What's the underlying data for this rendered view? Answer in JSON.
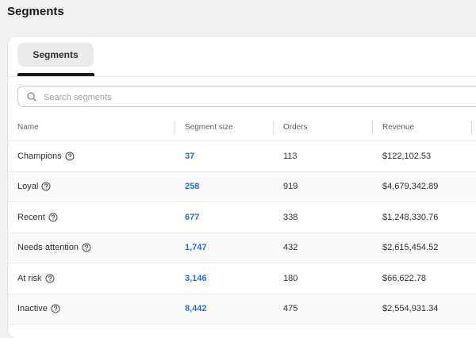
{
  "page": {
    "title": "Segments"
  },
  "tabs": [
    {
      "label": "Segments",
      "selected": true
    }
  ],
  "search": {
    "placeholder": "Search segments",
    "value": ""
  },
  "table": {
    "columns": [
      "Name",
      "Segment size",
      "Orders",
      "Revenue"
    ],
    "rows": [
      {
        "name": "Champions",
        "size": "37",
        "orders": "113",
        "revenue": "$122,102.53"
      },
      {
        "name": "Loyal",
        "size": "258",
        "orders": "919",
        "revenue": "$4,679,342.89"
      },
      {
        "name": "Recent",
        "size": "677",
        "orders": "338",
        "revenue": "$1,248,330.76"
      },
      {
        "name": "Needs attention",
        "size": "1,747",
        "orders": "432",
        "revenue": "$2,615,454.52"
      },
      {
        "name": "At risk",
        "size": "3,146",
        "orders": "180",
        "revenue": "$66,622.78"
      },
      {
        "name": "Inactive",
        "size": "8,442",
        "orders": "475",
        "revenue": "$2,554,931.34"
      }
    ]
  },
  "icons": {
    "search": "search-icon",
    "help": "help-circle-icon"
  },
  "colors": {
    "link": "#2c6ecb",
    "accent": "#1a1a1a",
    "background": "#f1f1f1"
  }
}
